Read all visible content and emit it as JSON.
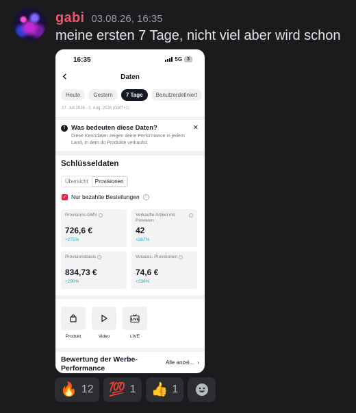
{
  "message": {
    "username": "gabi",
    "timestamp": "03.08.26, 16:35",
    "text": "meine ersten 7 Tage, nicht viel aber wird schon",
    "username_color": "#f0556b"
  },
  "phone": {
    "status": {
      "time": "16:35",
      "network": "5G",
      "battery": "3"
    },
    "nav": {
      "title": "Daten"
    },
    "tabs": [
      {
        "label": "Heute",
        "active": false
      },
      {
        "label": "Gestern",
        "active": false
      },
      {
        "label": "7 Tage",
        "active": true
      },
      {
        "label": "Benutzerdefiniert",
        "active": false
      }
    ],
    "date_range": "27. Juli 2026 - 2. Aug. 2026 (GMT+1)",
    "info": {
      "title": "Was bedeuten diese Daten?",
      "description": "Diese Kenndaten zeigen deine Performance in jedem Land, in dem du Produkte verkaufst."
    },
    "key_data": {
      "title": "Schlüsseldaten",
      "segments": [
        {
          "label": "Übersicht",
          "active": false
        },
        {
          "label": "Provisionen",
          "active": true
        }
      ],
      "checkbox_label": "Nur bezahlte Bestellungen",
      "checkbox_checked": true,
      "cards": [
        {
          "label": "Provisions-GMV",
          "value": "726,6 €",
          "delta": "+275%"
        },
        {
          "label": "Verkaufte Artikel mit Provision",
          "value": "42",
          "delta": "+367%"
        },
        {
          "label": "Provisionsbasis",
          "value": "834,73 €",
          "delta": "+290%"
        },
        {
          "label": "Vorauss. Provisionen",
          "value": "74,6 €",
          "delta": "+336%"
        }
      ]
    },
    "tools": [
      {
        "label": "Produkt",
        "icon": "shopping-bag-icon"
      },
      {
        "label": "Video",
        "icon": "play-icon"
      },
      {
        "label": "LIVE",
        "icon": "live-tv-icon"
      }
    ],
    "rating": {
      "title": "Bewertung der Werbe-Performance",
      "link": "Alle anzei..."
    }
  },
  "reactions": [
    {
      "emoji": "🔥",
      "count": "12",
      "icon": "fire-emoji"
    },
    {
      "emoji": "💯",
      "count": "1",
      "icon": "hundred-points-emoji"
    },
    {
      "emoji": "👍",
      "count": "1",
      "icon": "thumbs-up-emoji"
    }
  ],
  "add_reaction_icon": "add-reaction-icon"
}
